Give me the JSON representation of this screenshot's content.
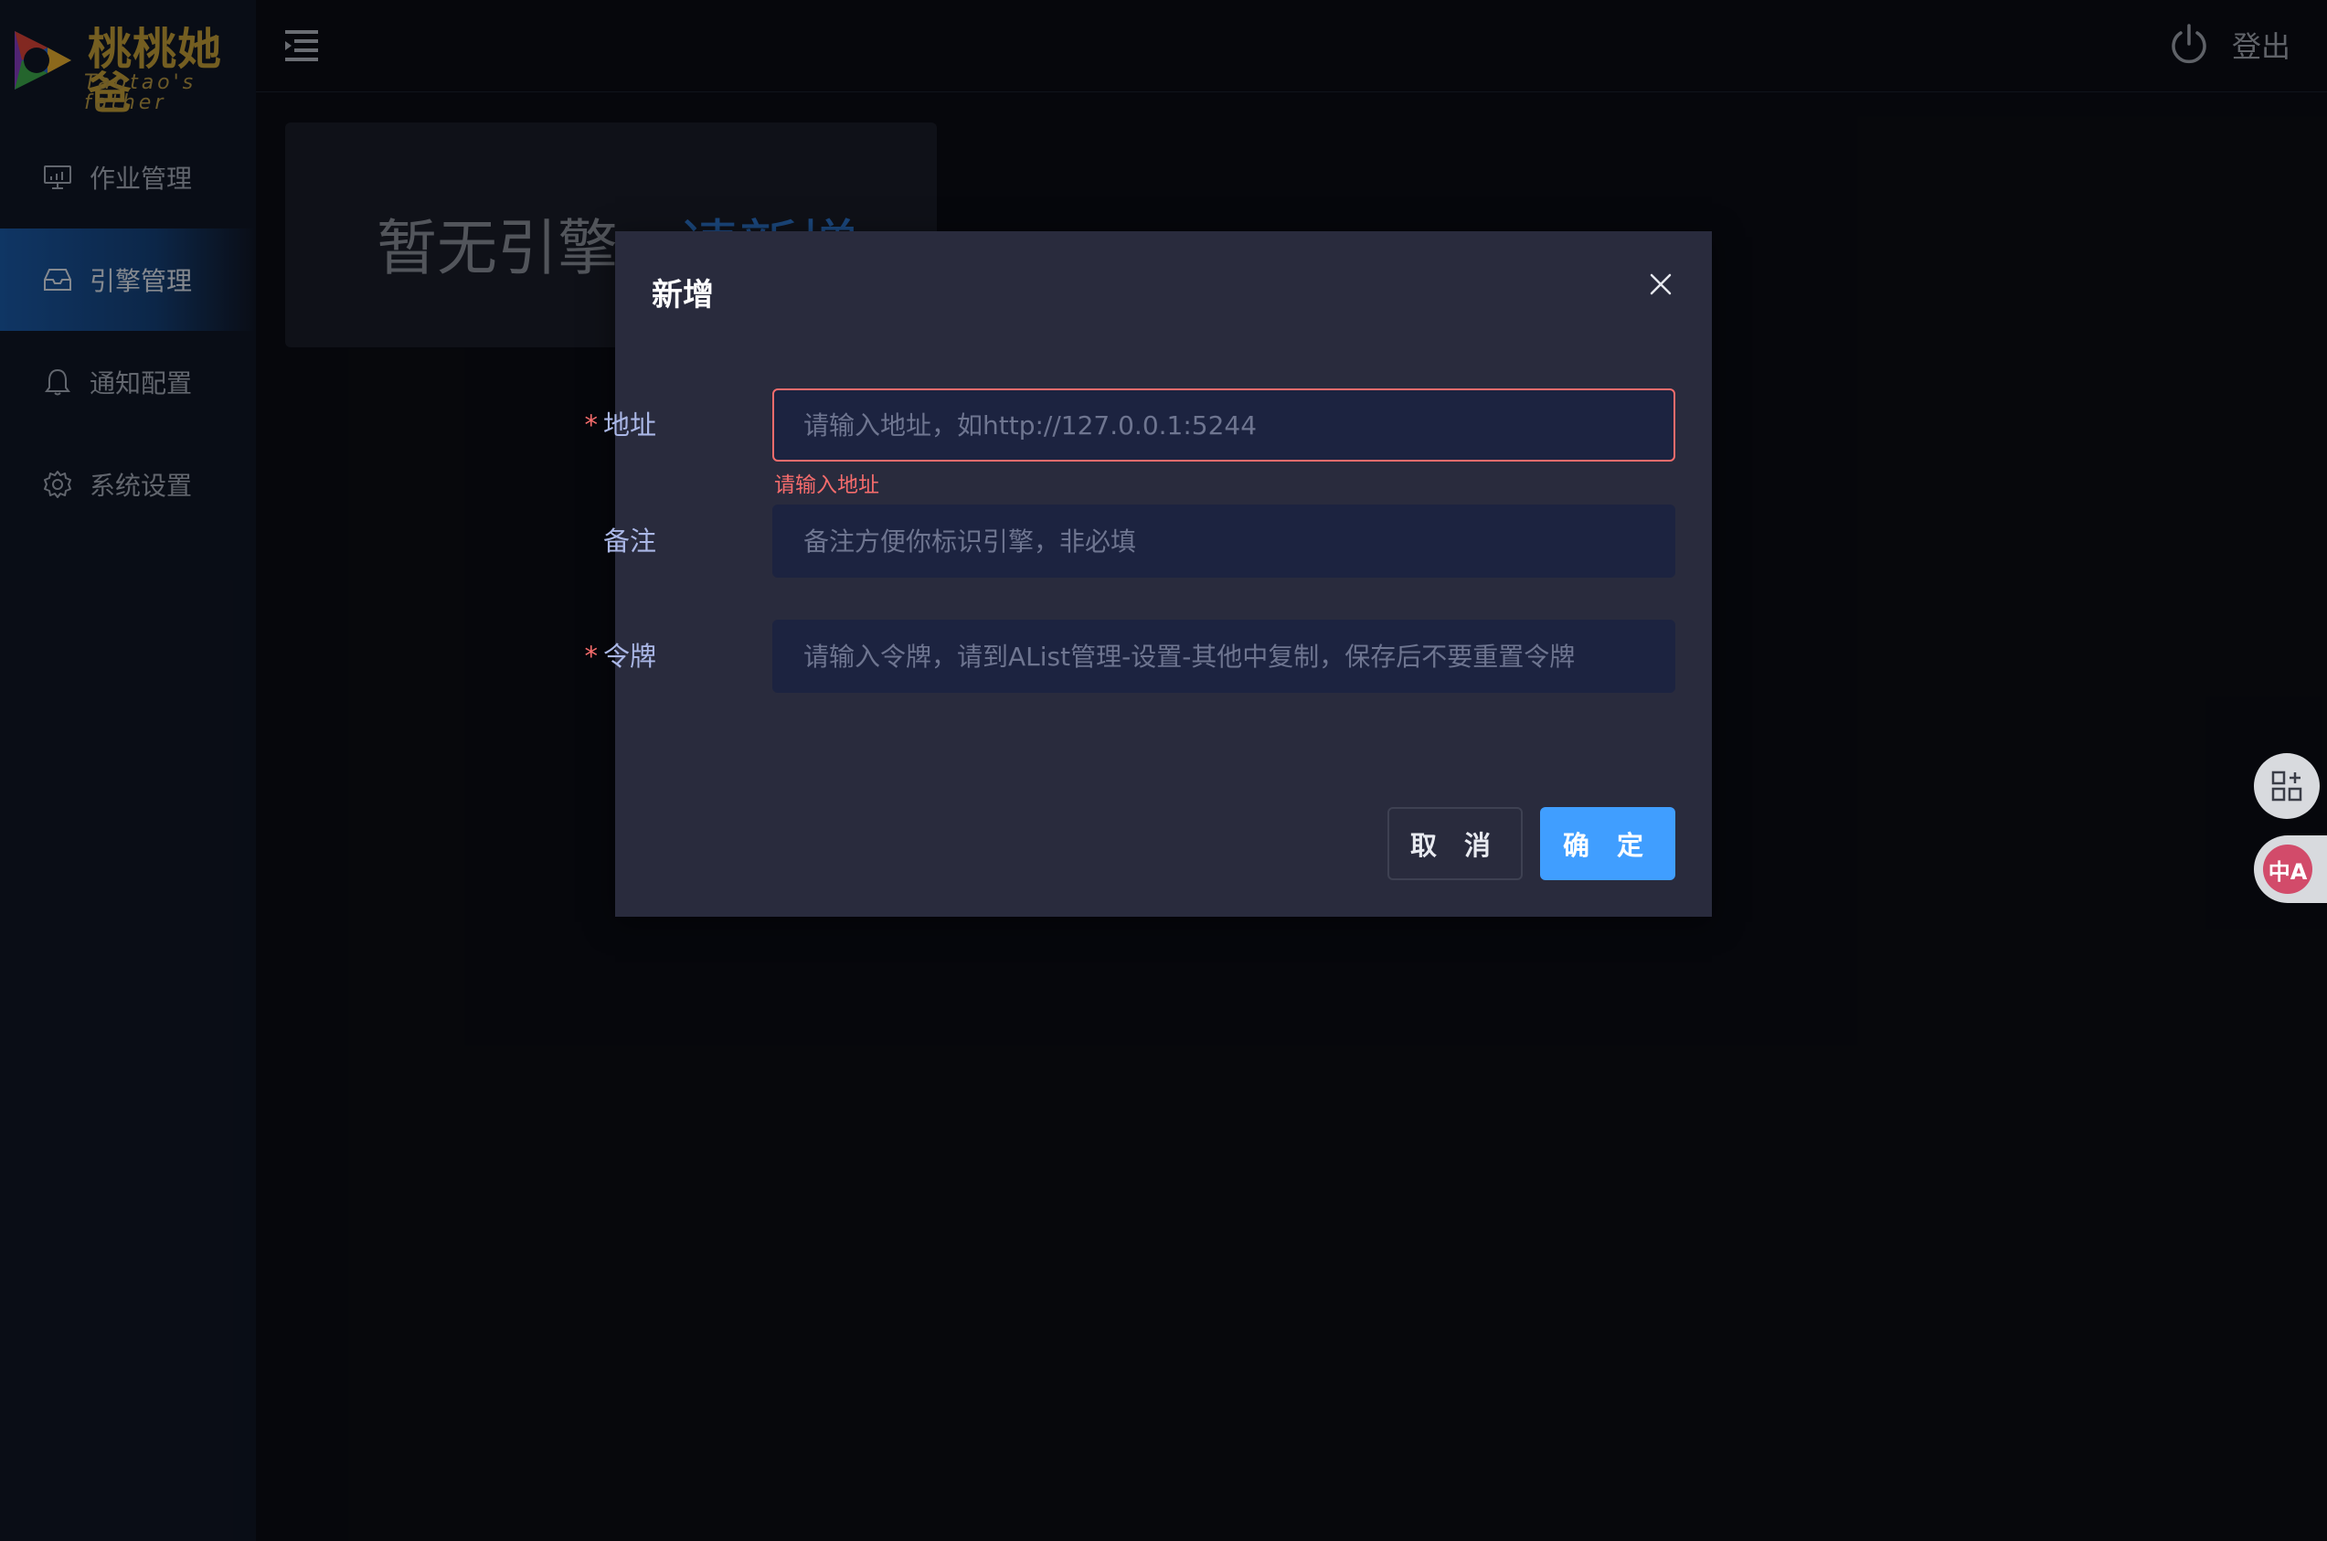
{
  "brand": {
    "title": "桃桃她爸",
    "subtitle": "Taotao's father"
  },
  "sidebar": {
    "items": [
      {
        "label": "作业管理",
        "icon": "monitor-icon",
        "active": false
      },
      {
        "label": "引擎管理",
        "icon": "inbox-icon",
        "active": true
      },
      {
        "label": "通知配置",
        "icon": "bell-icon",
        "active": false
      },
      {
        "label": "系统设置",
        "icon": "gear-icon",
        "active": false
      }
    ]
  },
  "header": {
    "logout_label": "登出"
  },
  "empty_state": {
    "text": "暂无引擎，",
    "link_text": "请新增"
  },
  "modal": {
    "title": "新增",
    "fields": {
      "address": {
        "label": "地址",
        "required": true,
        "value": "",
        "placeholder": "请输入地址，如http://127.0.0.1:5244",
        "error": "请输入地址"
      },
      "note": {
        "label": "备注",
        "required": false,
        "value": "",
        "placeholder": "备注方便你标识引擎，非必填"
      },
      "token": {
        "label": "令牌",
        "required": true,
        "value": "",
        "placeholder": "请输入令牌，请到AList管理-设置-其他中复制，保存后不要重置令牌"
      }
    },
    "cancel_label": "取 消",
    "confirm_label": "确 定"
  },
  "colors": {
    "accent": "#409eff",
    "error": "#f56c6c",
    "brand_gold": "#c9a23a",
    "link": "#2f7bd8"
  },
  "floating": {
    "translate_glyph": "中A"
  }
}
